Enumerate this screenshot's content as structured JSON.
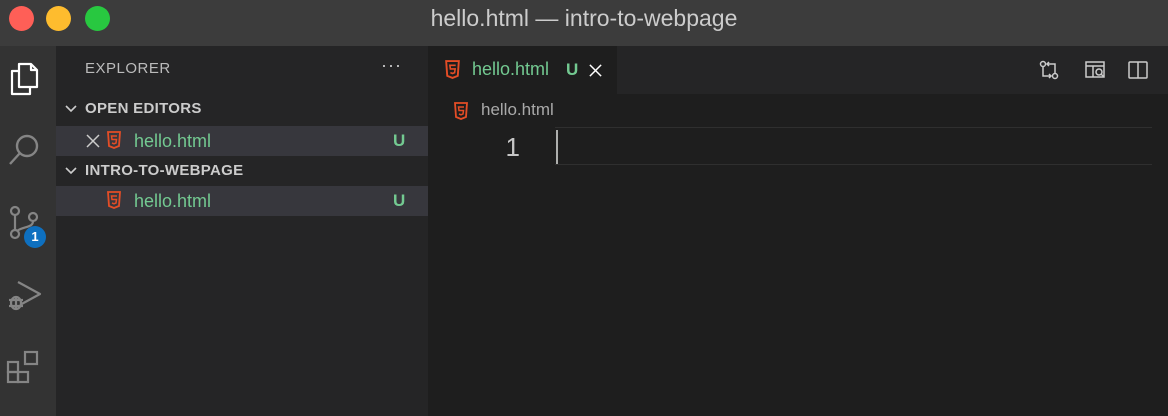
{
  "window": {
    "title": "hello.html — intro-to-webpage",
    "traffic_lights": [
      {
        "name": "close",
        "color": "#ff5f57"
      },
      {
        "name": "minimize",
        "color": "#febc2e"
      },
      {
        "name": "zoom",
        "color": "#28c840"
      }
    ]
  },
  "activity_bar": {
    "items": [
      {
        "name": "explorer-icon",
        "active": true
      },
      {
        "name": "search-icon",
        "active": false
      },
      {
        "name": "source-control-icon",
        "active": false,
        "badge": "1"
      },
      {
        "name": "run-debug-icon",
        "active": false
      },
      {
        "name": "extensions-icon",
        "active": false
      }
    ]
  },
  "sidebar": {
    "title": "EXPLORER",
    "more": "···",
    "open_editors": {
      "label": "OPEN EDITORS",
      "items": [
        {
          "filename": "hello.html",
          "status": "U",
          "icon": "html5-icon"
        }
      ]
    },
    "folder": {
      "label": "INTRO-TO-WEBPAGE",
      "items": [
        {
          "filename": "hello.html",
          "status": "U",
          "icon": "html5-icon"
        }
      ]
    }
  },
  "editor": {
    "tab": {
      "filename": "hello.html",
      "status": "U"
    },
    "actions": [
      "open-changes-icon",
      "open-preview-icon",
      "split-editor-icon"
    ],
    "breadcrumb": {
      "filename": "hello.html"
    },
    "line_numbers": [
      "1"
    ]
  },
  "colors": {
    "untracked": "#73c991",
    "badge": "#0e70c0",
    "html5": "#e44d26"
  }
}
